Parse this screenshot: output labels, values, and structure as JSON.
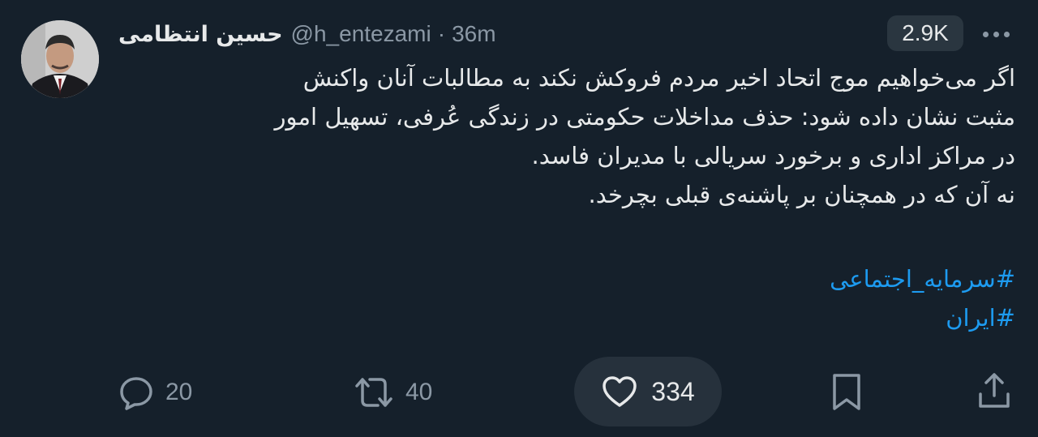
{
  "tweet": {
    "author_name": "حسین انتظامی",
    "handle": "@h_entezami",
    "separator": "·",
    "time": "36m",
    "views": "2.9K",
    "body_lines": [
      "اگر می‌خواهیم موج اتحاد اخیر مردم فروکش نکند به مطالبات آنان واکنش",
      "مثبت نشان داده شود: حذف مداخلات حکومتی در زندگی عُرفی، تسهیل امور",
      "در مراکز اداری و برخورد سریالی با مدیران فاسد.",
      "نه آن که در همچنان بر پاشنه‌ی قبلی بچرخد."
    ],
    "hashtags": [
      "#سرمایه_اجتماعی",
      "#ایران"
    ]
  },
  "actions": {
    "replies": "20",
    "retweets": "40",
    "likes": "334"
  },
  "colors": {
    "background": "#15202b",
    "text": "#e7e9ea",
    "muted": "#8b98a5",
    "link": "#1d9bf0",
    "pill": "#26313c"
  },
  "icons": [
    "avatar-photo",
    "more-icon",
    "reply-icon",
    "retweet-icon",
    "heart-icon",
    "bookmark-icon",
    "share-icon"
  ]
}
